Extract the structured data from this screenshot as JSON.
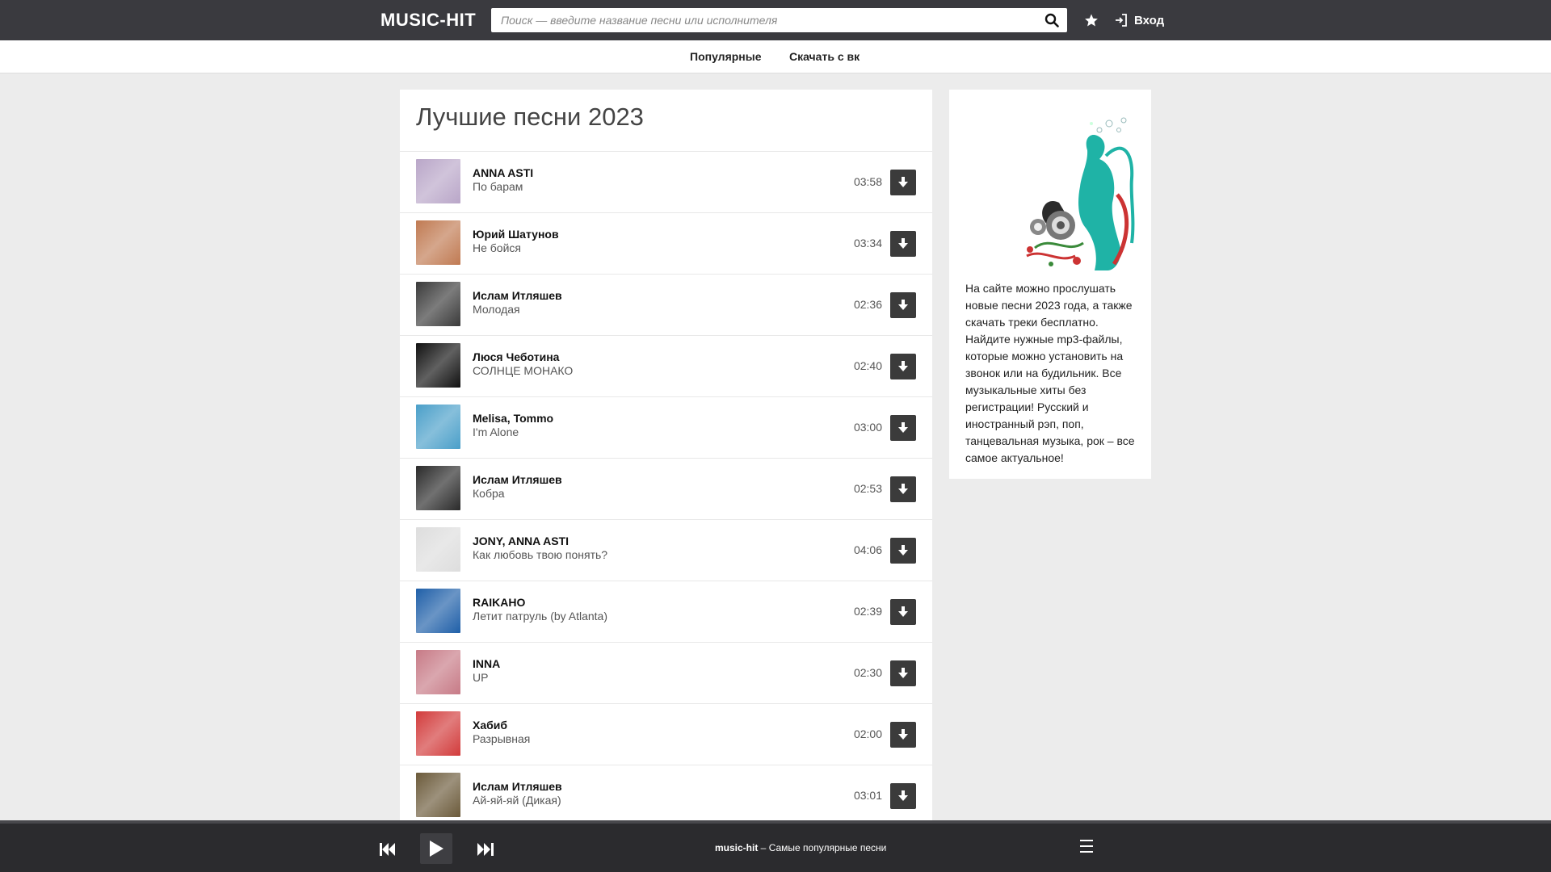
{
  "header": {
    "logo": "MUSIC-HIT",
    "search_placeholder": "Поиск — введите название песни или исполнителя",
    "login_label": "Вход"
  },
  "nav": {
    "items": [
      {
        "label": "Популярные"
      },
      {
        "label": "Скачать с вк"
      }
    ]
  },
  "main": {
    "title": "Лучшие песни 2023",
    "tracks": [
      {
        "artist": "ANNA ASTI",
        "title": "По барам",
        "duration": "03:58",
        "cover_color": "#b9a6c8"
      },
      {
        "artist": "Юрий Шатунов",
        "title": "Не бойся",
        "duration": "03:34",
        "cover_color": "#c07a52"
      },
      {
        "artist": "Ислам Итляшев",
        "title": "Молодая",
        "duration": "02:36",
        "cover_color": "#3a3a3a"
      },
      {
        "artist": "Люся Чеботина",
        "title": "СОЛНЦЕ МОНАКО",
        "duration": "02:40",
        "cover_color": "#111111"
      },
      {
        "artist": "Melisa, Tommo",
        "title": "I'm Alone",
        "duration": "03:00",
        "cover_color": "#4a9fc9"
      },
      {
        "artist": "Ислам Итляшев",
        "title": "Кобра",
        "duration": "02:53",
        "cover_color": "#2a2a2a"
      },
      {
        "artist": "JONY, ANNA ASTI",
        "title": "Как любовь твою понять?",
        "duration": "04:06",
        "cover_color": "#dddddd"
      },
      {
        "artist": "RAIKAHO",
        "title": "Летит патруль (by Atlanta)",
        "duration": "02:39",
        "cover_color": "#1f5fa8"
      },
      {
        "artist": "INNA",
        "title": "UP",
        "duration": "02:30",
        "cover_color": "#c77a86"
      },
      {
        "artist": "Хабиб",
        "title": "Разрывная",
        "duration": "02:00",
        "cover_color": "#d23b3b"
      },
      {
        "artist": "Ислам Итляшев",
        "title": "Ай-яй-яй (Дикая)",
        "duration": "03:01",
        "cover_color": "#6b5a3a"
      },
      {
        "artist": "",
        "title": "",
        "duration": "",
        "cover_color": "#333333"
      }
    ]
  },
  "sidebar": {
    "description": "На сайте можно прослушать новые песни 2023 года, а также скачать треки бесплатно. Найдите нужные mp3-файлы, которые можно установить на звонок или на будильник. Все музыкальные хиты без регистрации! Русский и иностранный рэп, поп, танцевальная музыка, рок – все самое актуальное!"
  },
  "player": {
    "brand": "music-hit",
    "separator": " – ",
    "subtitle": "Самые популярные песни"
  },
  "colors": {
    "header_bg": "#3a3a3f",
    "page_bg": "#ececec",
    "button_dark": "#3b3b3b",
    "player_bg": "#2b2b2e",
    "accent_teal": "#1fb3a6"
  },
  "icons": {
    "search": "search-icon",
    "favorite": "star-icon",
    "login": "login-icon",
    "download": "download-arrow-icon",
    "prev": "previous-track-icon",
    "play": "play-icon",
    "next": "next-track-icon",
    "menu": "hamburger-menu-icon"
  }
}
